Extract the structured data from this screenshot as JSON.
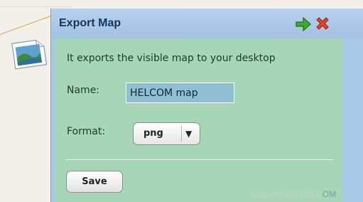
{
  "dialog": {
    "title": "Export Map",
    "description": "It exports the visible map to your desktop",
    "icons": {
      "export_arrow": "green-arrow-icon",
      "close": "red-x-close-icon",
      "thumbnail": "map-image-icon"
    }
  },
  "form": {
    "name_label": "Name:",
    "name_value": "HELCOM map",
    "format_label": "Format:",
    "format_value": "png",
    "save_label": "Save"
  },
  "footer": {
    "copyright_main": "Copyright © HELC",
    "copyright_tail": "OM"
  },
  "colors": {
    "titlebar": "#a9c7e6",
    "content": "#a6d6b5",
    "title_text": "#12355e"
  }
}
